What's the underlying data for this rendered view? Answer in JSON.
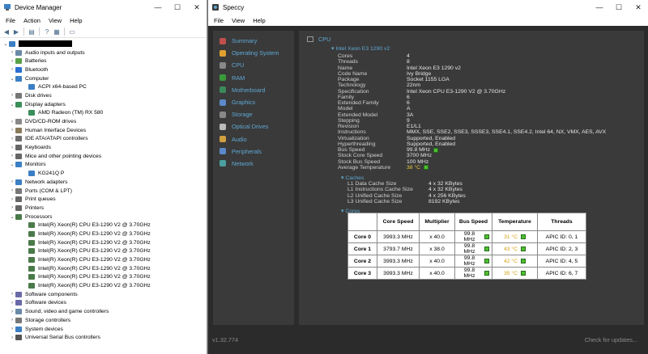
{
  "device_manager": {
    "title": "Device Manager",
    "menu": [
      "File",
      "Action",
      "View",
      "Help"
    ],
    "tree": [
      {
        "level": 0,
        "exp": "v",
        "label": "",
        "redacted": true,
        "icon": "computer-icon",
        "color": "#3b7fc4"
      },
      {
        "level": 1,
        "exp": ">",
        "label": "Audio inputs and outputs",
        "icon": "speaker-icon",
        "color": "#6b8aa8"
      },
      {
        "level": 1,
        "exp": ">",
        "label": "Batteries",
        "icon": "battery-icon",
        "color": "#5aa04a"
      },
      {
        "level": 1,
        "exp": ">",
        "label": "Bluetooth",
        "icon": "bluetooth-icon",
        "color": "#2a6fd1"
      },
      {
        "level": 1,
        "exp": "v",
        "label": "Computer",
        "icon": "computer-icon",
        "color": "#3b7fc4"
      },
      {
        "level": 2,
        "exp": "",
        "label": "ACPI x64-based PC",
        "icon": "monitor-icon",
        "color": "#3b7fc4"
      },
      {
        "level": 1,
        "exp": ">",
        "label": "Disk drives",
        "icon": "disk-icon",
        "color": "#777777"
      },
      {
        "level": 1,
        "exp": "v",
        "label": "Display adapters",
        "icon": "display-adapter-icon",
        "color": "#3a8f5a"
      },
      {
        "level": 2,
        "exp": "",
        "label": "AMD Radeon (TM) RX 580",
        "icon": "display-adapter-icon",
        "color": "#3a8f5a"
      },
      {
        "level": 1,
        "exp": ">",
        "label": "DVD/CD-ROM drives",
        "icon": "dvd-icon",
        "color": "#888888"
      },
      {
        "level": 1,
        "exp": ">",
        "label": "Human Interface Devices",
        "icon": "hid-icon",
        "color": "#8a7a5a"
      },
      {
        "level": 1,
        "exp": ">",
        "label": "IDE ATA/ATAPI controllers",
        "icon": "ide-icon",
        "color": "#6d6d6d"
      },
      {
        "level": 1,
        "exp": ">",
        "label": "Keyboards",
        "icon": "keyboard-icon",
        "color": "#666666"
      },
      {
        "level": 1,
        "exp": ">",
        "label": "Mice and other pointing devices",
        "icon": "mouse-icon",
        "color": "#666666"
      },
      {
        "level": 1,
        "exp": "v",
        "label": "Monitors",
        "icon": "monitor-icon",
        "color": "#3b7fc4"
      },
      {
        "level": 2,
        "exp": "",
        "label": "KG241Q P",
        "icon": "monitor-icon",
        "color": "#3b7fc4"
      },
      {
        "level": 1,
        "exp": ">",
        "label": "Network adapters",
        "icon": "network-icon",
        "color": "#3b7fc4"
      },
      {
        "level": 1,
        "exp": ">",
        "label": "Ports (COM & LPT)",
        "icon": "port-icon",
        "color": "#777777"
      },
      {
        "level": 1,
        "exp": ">",
        "label": "Print queues",
        "icon": "printer-icon",
        "color": "#666666"
      },
      {
        "level": 1,
        "exp": ">",
        "label": "Printers",
        "icon": "printer-icon",
        "color": "#666666"
      },
      {
        "level": 1,
        "exp": "v",
        "label": "Processors",
        "icon": "processor-icon",
        "color": "#4a7a4a"
      },
      {
        "level": 2,
        "exp": "",
        "label": "Intel(R) Xeon(R) CPU E3-1290 V2 @ 3.70GHz",
        "icon": "processor-icon",
        "color": "#4a7a4a"
      },
      {
        "level": 2,
        "exp": "",
        "label": "Intel(R) Xeon(R) CPU E3-1290 V2 @ 3.70GHz",
        "icon": "processor-icon",
        "color": "#4a7a4a"
      },
      {
        "level": 2,
        "exp": "",
        "label": "Intel(R) Xeon(R) CPU E3-1290 V2 @ 3.70GHz",
        "icon": "processor-icon",
        "color": "#4a7a4a"
      },
      {
        "level": 2,
        "exp": "",
        "label": "Intel(R) Xeon(R) CPU E3-1290 V2 @ 3.70GHz",
        "icon": "processor-icon",
        "color": "#4a7a4a"
      },
      {
        "level": 2,
        "exp": "",
        "label": "Intel(R) Xeon(R) CPU E3-1290 V2 @ 3.70GHz",
        "icon": "processor-icon",
        "color": "#4a7a4a"
      },
      {
        "level": 2,
        "exp": "",
        "label": "Intel(R) Xeon(R) CPU E3-1290 V2 @ 3.70GHz",
        "icon": "processor-icon",
        "color": "#4a7a4a"
      },
      {
        "level": 2,
        "exp": "",
        "label": "Intel(R) Xeon(R) CPU E3-1290 V2 @ 3.70GHz",
        "icon": "processor-icon",
        "color": "#4a7a4a"
      },
      {
        "level": 2,
        "exp": "",
        "label": "Intel(R) Xeon(R) CPU E3-1290 V2 @ 3.70GHz",
        "icon": "processor-icon",
        "color": "#4a7a4a"
      },
      {
        "level": 1,
        "exp": ">",
        "label": "Software components",
        "icon": "software-icon",
        "color": "#6a6aa8"
      },
      {
        "level": 1,
        "exp": ">",
        "label": "Software devices",
        "icon": "software-icon",
        "color": "#6a6aa8"
      },
      {
        "level": 1,
        "exp": ">",
        "label": "Sound, video and game controllers",
        "icon": "speaker-icon",
        "color": "#6b8aa8"
      },
      {
        "level": 1,
        "exp": ">",
        "label": "Storage controllers",
        "icon": "storage-icon",
        "color": "#777777"
      },
      {
        "level": 1,
        "exp": ">",
        "label": "System devices",
        "icon": "system-icon",
        "color": "#3b7fc4"
      },
      {
        "level": 1,
        "exp": ">",
        "label": "Universal Serial Bus controllers",
        "icon": "usb-icon",
        "color": "#555555"
      }
    ]
  },
  "speccy": {
    "title": "Speccy",
    "menu": [
      "File",
      "View",
      "Help"
    ],
    "nav": [
      {
        "label": "Summary",
        "icon": "summary-icon",
        "color": "#c0504d"
      },
      {
        "label": "Operating System",
        "icon": "windows-icon",
        "color": "#e0a030"
      },
      {
        "label": "CPU",
        "icon": "cpu-icon",
        "color": "#888888"
      },
      {
        "label": "RAM",
        "icon": "ram-icon",
        "color": "#3a9a3a"
      },
      {
        "label": "Motherboard",
        "icon": "motherboard-icon",
        "color": "#3a8a5a"
      },
      {
        "label": "Graphics",
        "icon": "graphics-icon",
        "color": "#5a8ac8"
      },
      {
        "label": "Storage",
        "icon": "storage-icon",
        "color": "#888888"
      },
      {
        "label": "Optical Drives",
        "icon": "optical-icon",
        "color": "#bbbbbb"
      },
      {
        "label": "Audio",
        "icon": "audio-icon",
        "color": "#d0a040"
      },
      {
        "label": "Peripherals",
        "icon": "peripherals-icon",
        "color": "#5a8ac8"
      },
      {
        "label": "Network",
        "icon": "network-icon",
        "color": "#4aa0a0"
      }
    ],
    "section_title": "CPU",
    "model_header": "Intel Xeon E3 1290 v2",
    "props": [
      {
        "k": "Cores",
        "v": "4"
      },
      {
        "k": "Threads",
        "v": "8"
      },
      {
        "k": "Name",
        "v": "Intel Xeon E3 1290 v2"
      },
      {
        "k": "Code Name",
        "v": "Ivy Bridge"
      },
      {
        "k": "Package",
        "v": "Socket 1155 LGA"
      },
      {
        "k": "Technology",
        "v": "22nm"
      },
      {
        "k": "Specification",
        "v": "Intel Xeon CPU E3-1290 V2 @ 3.70GHz"
      },
      {
        "k": "Family",
        "v": "6"
      },
      {
        "k": "Extended Family",
        "v": "6"
      },
      {
        "k": "Model",
        "v": "A"
      },
      {
        "k": "Extended Model",
        "v": "3A"
      },
      {
        "k": "Stepping",
        "v": "9"
      },
      {
        "k": "Revision",
        "v": "E1/L1"
      },
      {
        "k": "Instructions",
        "v": "MMX, SSE, SSE2, SSE3, SSSE3, SSE4.1, SSE4.2, Intel 64, NX, VMX, AES, AVX"
      },
      {
        "k": "Virtualization",
        "v": "Supported, Enabled"
      },
      {
        "k": "Hyperthreading",
        "v": "Supported, Enabled"
      },
      {
        "k": "Bus Speed",
        "v": "99.8 MHz",
        "indicator": true
      },
      {
        "k": "Stock Core Speed",
        "v": "3700 MHz"
      },
      {
        "k": "Stock Bus Speed",
        "v": "100 MHz"
      },
      {
        "k": "Average Temperature",
        "v": "38 °C",
        "indicator": true,
        "hot": true
      }
    ],
    "caches_label": "Caches",
    "caches": [
      {
        "k": "L1 Data Cache Size",
        "v": "4 x 32 KBytes"
      },
      {
        "k": "L1 Instructions Cache Size",
        "v": "4 x 32 KBytes"
      },
      {
        "k": "L2 Unified Cache Size",
        "v": "4 x 256 KBytes"
      },
      {
        "k": "L3 Unified Cache Size",
        "v": "8192 KBytes"
      }
    ],
    "cores_label": "Cores",
    "cores_table": {
      "headers": [
        "",
        "Core Speed",
        "Multiplier",
        "Bus Speed",
        "Temperature",
        "Threads"
      ],
      "rows": [
        {
          "name": "Core 0",
          "speed": "3993.3 MHz",
          "mult": "x 40.0",
          "bus": "99.8 MHz",
          "temp": "31 °C",
          "threads": "APIC ID: 0, 1"
        },
        {
          "name": "Core 1",
          "speed": "3793.7 MHz",
          "mult": "x 38.0",
          "bus": "99.8 MHz",
          "temp": "43 °C",
          "threads": "APIC ID: 2, 3"
        },
        {
          "name": "Core 2",
          "speed": "3993.3 MHz",
          "mult": "x 40.0",
          "bus": "99.8 MHz",
          "temp": "42 °C",
          "threads": "APIC ID: 4, 5"
        },
        {
          "name": "Core 3",
          "speed": "3993.3 MHz",
          "mult": "x 40.0",
          "bus": "99.8 MHz",
          "temp": "35 °C",
          "threads": "APIC ID: 6, 7"
        }
      ]
    },
    "version": "v1.32.774",
    "update_link": "Check for updates..."
  }
}
